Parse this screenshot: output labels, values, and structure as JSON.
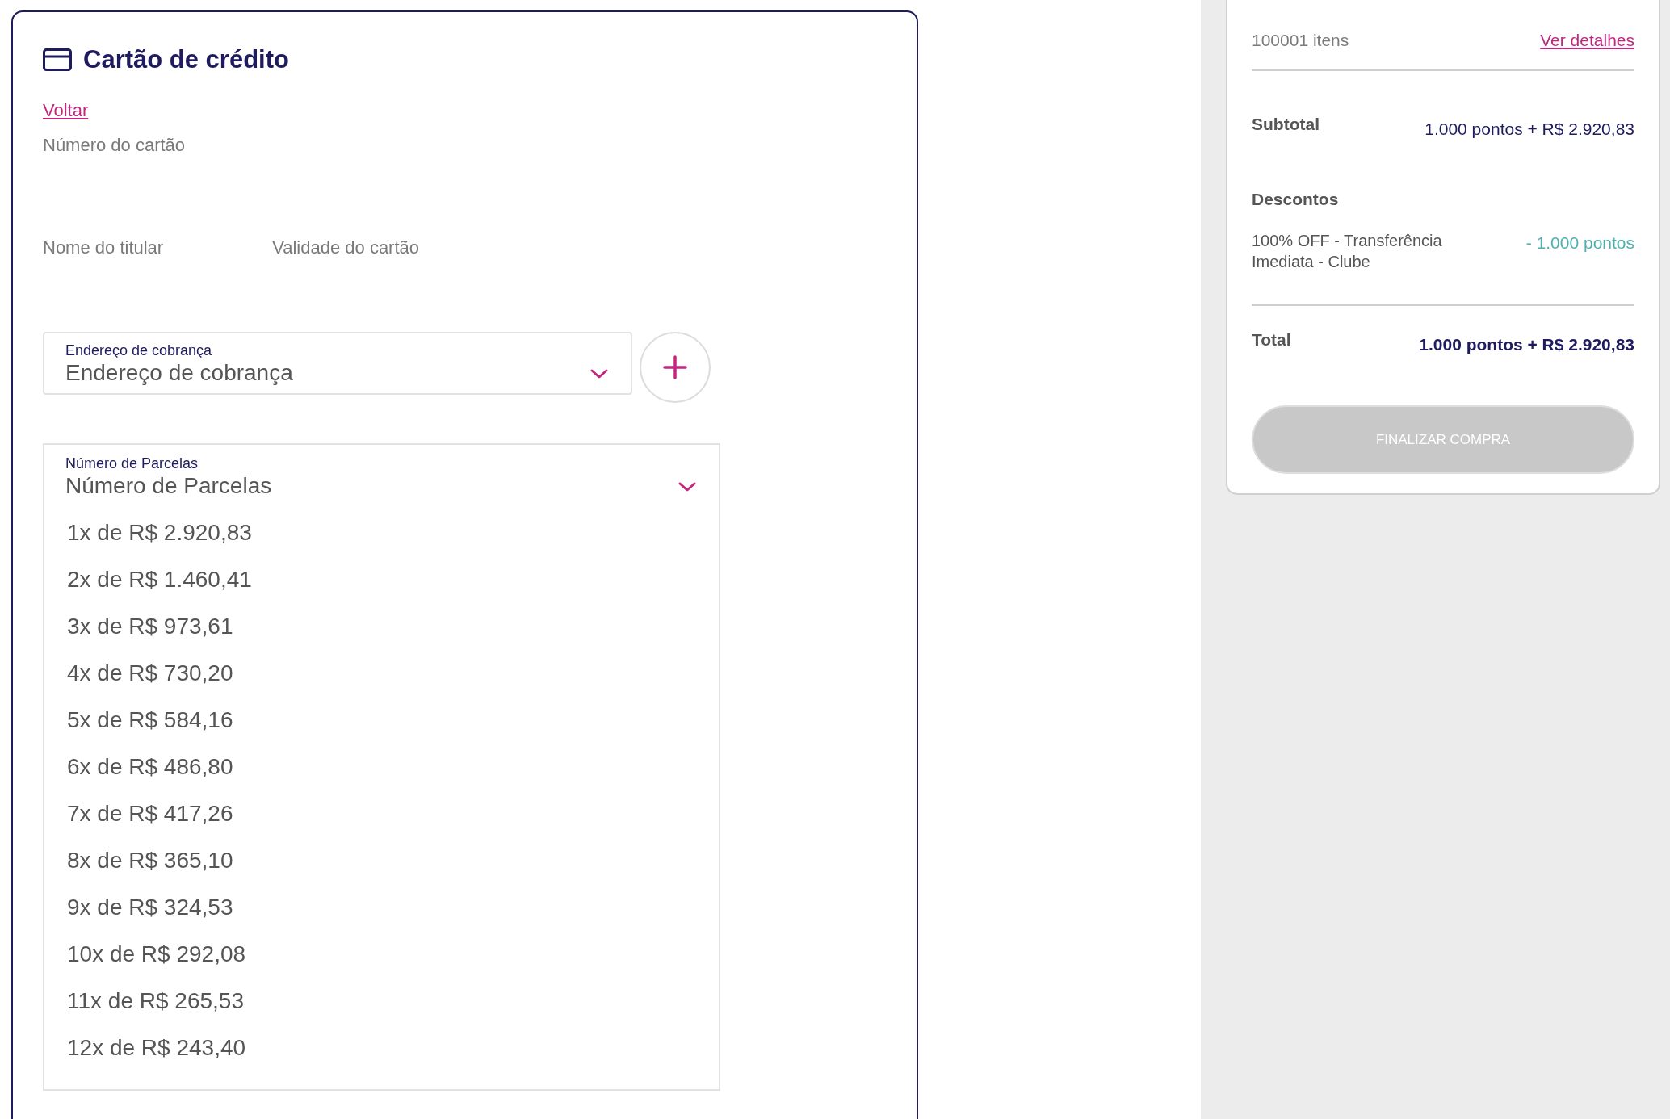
{
  "payment_card": {
    "title": "Cartão de crédito",
    "back_link": "Voltar",
    "fields": [
      {
        "label": "Número do cartão"
      },
      {
        "label": "Nome do titular"
      },
      {
        "label": "Validade do cartão"
      }
    ],
    "billing_address": {
      "label": "Endereço de cobrança",
      "value": "Endereço de cobrança"
    },
    "installments": {
      "label": "Número de Parcelas",
      "value": "Número de Parcelas",
      "expanded": true,
      "options": [
        "1x de R$ 2.920,83",
        "2x de R$ 1.460,41",
        "3x de R$ 973,61",
        "4x de R$ 730,20",
        "5x de R$ 584,16",
        "6x de R$ 486,80",
        "7x de R$ 417,26",
        "8x de R$ 365,10",
        "9x de R$ 324,53",
        "10x de R$ 292,08",
        "11x de R$ 265,53",
        "12x de R$ 243,40"
      ]
    }
  },
  "summary": {
    "items_count": "100001 itens",
    "details_link": "Ver detalhes",
    "subtotal": {
      "label": "Subtotal",
      "value": "1.000 pontos + R$ 2.920,83"
    },
    "discounts": {
      "label": "Descontos",
      "items": [
        {
          "name": "100% OFF - Transferência Imediata - Clube",
          "value": "- 1.000 pontos"
        }
      ]
    },
    "total": {
      "label": "Total",
      "value": "1.000 pontos + R$ 2.920,83"
    },
    "checkout_button": {
      "label": "FINALIZAR COMPRA",
      "disabled": true
    }
  }
}
